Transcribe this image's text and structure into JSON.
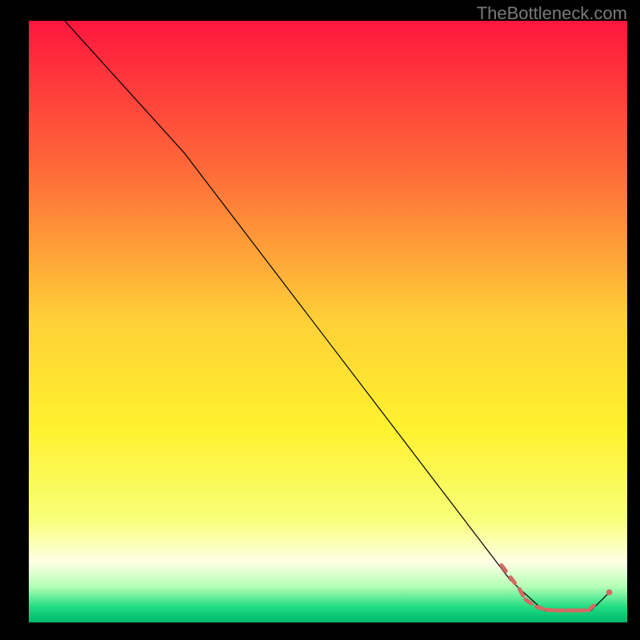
{
  "watermark": "TheBottleneck.com",
  "chart_data": {
    "type": "line",
    "title": "",
    "xlabel": "",
    "ylabel": "",
    "xlim": [
      0,
      100
    ],
    "ylim": [
      0,
      100
    ],
    "grid": false,
    "legend": false,
    "background_gradient": {
      "stops": [
        {
          "offset": 0.0,
          "color": "#ff163e"
        },
        {
          "offset": 0.25,
          "color": "#ff6b3a"
        },
        {
          "offset": 0.5,
          "color": "#ffd137"
        },
        {
          "offset": 0.68,
          "color": "#fff22e"
        },
        {
          "offset": 0.83,
          "color": "#f8ff7a"
        },
        {
          "offset": 0.9,
          "color": "#ffffe6"
        },
        {
          "offset": 0.94,
          "color": "#b6ffb6"
        },
        {
          "offset": 0.975,
          "color": "#1fdc82"
        },
        {
          "offset": 1.0,
          "color": "#00b86a"
        }
      ]
    },
    "series": [
      {
        "name": "curve",
        "color": "#000000",
        "stroke_width": 1.2,
        "points_xy": [
          [
            6,
            100
          ],
          [
            26,
            78
          ],
          [
            80.5,
            7
          ],
          [
            86,
            2
          ],
          [
            94,
            2
          ],
          [
            97,
            5
          ]
        ]
      }
    ],
    "markers": {
      "name": "dash-segment",
      "color": "#d46a63",
      "stroke_width": 5,
      "cap": "round",
      "points_xy": [
        [
          79,
          9.5
        ],
        [
          80.5,
          7.5
        ],
        [
          82,
          5.5
        ],
        [
          83,
          3.8
        ],
        [
          84.8,
          2.6
        ],
        [
          86.5,
          2.1
        ],
        [
          88.2,
          2.0
        ],
        [
          90,
          2.0
        ],
        [
          91.7,
          2.0
        ],
        [
          93.5,
          2.0
        ],
        [
          97,
          5.0
        ]
      ],
      "dot_only_indices": [
        10
      ]
    }
  }
}
